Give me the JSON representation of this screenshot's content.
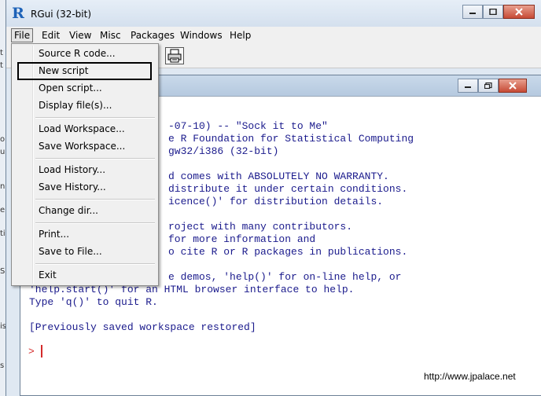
{
  "window": {
    "title": "RGui (32-bit)",
    "logo_letter": "R"
  },
  "menubar": {
    "items": [
      "File",
      "Edit",
      "View",
      "Misc",
      "Packages",
      "Windows",
      "Help"
    ]
  },
  "file_menu": {
    "items": [
      "Source R code...",
      "New script",
      "Open script...",
      "Display file(s)...",
      "Load Workspace...",
      "Save Workspace...",
      "Load History...",
      "Save History...",
      "Change dir...",
      "Print...",
      "Save to File...",
      "Exit"
    ],
    "highlighted": "New script"
  },
  "console": {
    "lines": [
      "-07-10) -- \"Sock it to Me\"",
      "e R Foundation for Statistical Computing",
      "gw32/i386 (32-bit)",
      "d comes with ABSOLUTELY NO WARRANTY.",
      "distribute it under certain conditions.",
      "icence()' for distribution details.",
      "roject with many contributors.",
      "for more information and",
      "o cite R or R packages in publications.",
      "e demos, 'help()' for on-line help, or",
      "'help.start()' for an HTML browser interface to help.",
      "Type 'q()' to quit R.",
      "[Previously saved workspace restored]"
    ],
    "prompt": ">"
  },
  "watermark": "http://www.jpalace.net",
  "colors": {
    "console_text": "#1a1a8c",
    "prompt": "#d42b2b",
    "close_button": "#c74a35"
  }
}
